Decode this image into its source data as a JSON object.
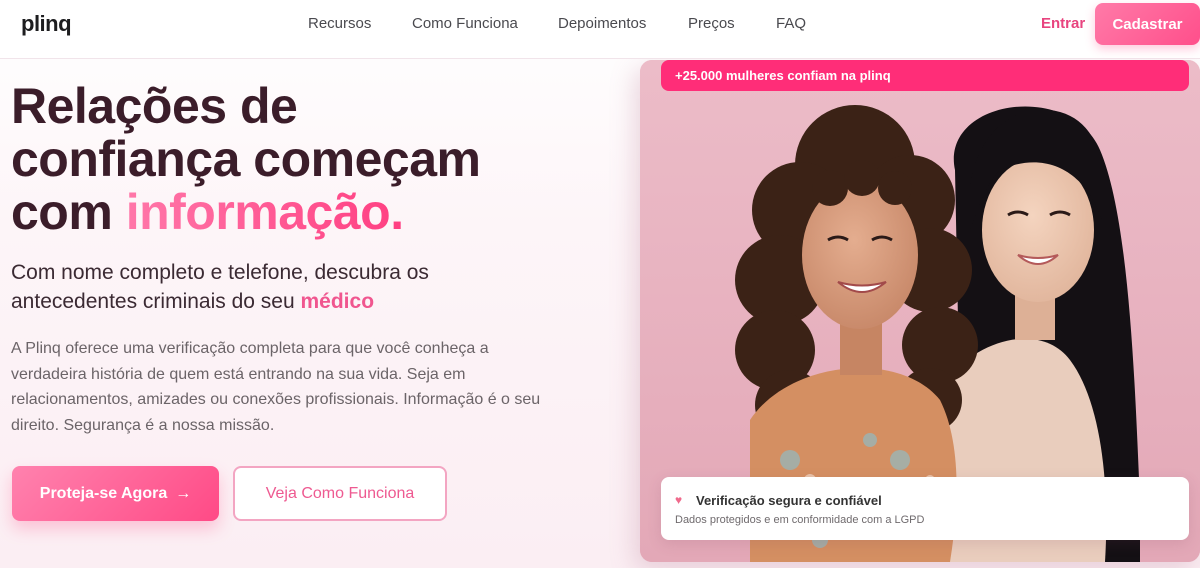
{
  "brand": {
    "logo": "plinq"
  },
  "nav": {
    "links": [
      "Recursos",
      "Como Funciona",
      "Depoimentos",
      "Preços",
      "FAQ"
    ],
    "login": "Entrar",
    "signup": "Cadastrar"
  },
  "hero": {
    "title_line1": "Relações de",
    "title_line2": "confiança começam",
    "title_line3_pre": "com ",
    "title_highlight": "informação.",
    "subtitle_pre": "Com nome completo e telefone, descubra os antecedentes criminais do seu ",
    "subtitle_accent": "médico",
    "description": "A Plinq oferece uma verificação completa para que você conheça a verdadeira história de quem está entrando na sua vida. Seja em relacionamentos, amizades ou conexões profissionais. Informação é o seu direito. Segurança é a nossa missão.",
    "cta_primary": "Proteja-se Agora",
    "cta_secondary": "Veja Como Funciona"
  },
  "image_panel": {
    "badge": "+25.000 mulheres confiam na plinq",
    "security_title": "Verificação segura e confiável",
    "security_subtitle": "Dados protegidos e em conformidade com a LGPD"
  },
  "icons": {
    "cta_arrow": "arrow-right-icon",
    "security_heart": "heart-icon"
  },
  "colors": {
    "accent": "#ff4f8b",
    "badge": "#ff2d78",
    "title": "#3b1d2a"
  }
}
